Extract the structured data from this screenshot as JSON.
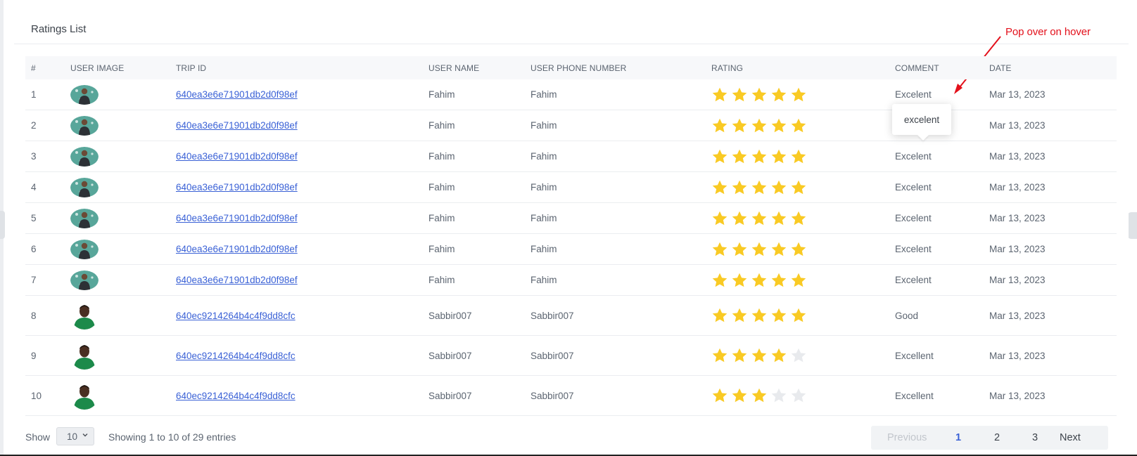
{
  "card": {
    "title": "Ratings List"
  },
  "annotation": {
    "text": "Pop over on hover"
  },
  "table": {
    "columns": [
      "#",
      "USER IMAGE",
      "TRIP ID",
      "USER NAME",
      "USER PHONE NUMBER",
      "RATING",
      "COMMENT",
      "DATE"
    ],
    "rows": [
      {
        "num": "1",
        "avatar": "avatar-outdoor",
        "trip_id": "640ea3e6e71901db2d0f98ef",
        "user_name": "Fahim",
        "phone": "Fahim",
        "rating": 5,
        "comment": "Excelent",
        "date": "Mar 13, 2023"
      },
      {
        "num": "2",
        "avatar": "avatar-outdoor",
        "trip_id": "640ea3e6e71901db2d0f98ef",
        "user_name": "Fahim",
        "phone": "Fahim",
        "rating": 5,
        "comment": "",
        "date": "Mar 13, 2023"
      },
      {
        "num": "3",
        "avatar": "avatar-outdoor",
        "trip_id": "640ea3e6e71901db2d0f98ef",
        "user_name": "Fahim",
        "phone": "Fahim",
        "rating": 5,
        "comment": "Excelent",
        "date": "Mar 13, 2023"
      },
      {
        "num": "4",
        "avatar": "avatar-outdoor",
        "trip_id": "640ea3e6e71901db2d0f98ef",
        "user_name": "Fahim",
        "phone": "Fahim",
        "rating": 5,
        "comment": "Excelent",
        "date": "Mar 13, 2023"
      },
      {
        "num": "5",
        "avatar": "avatar-outdoor",
        "trip_id": "640ea3e6e71901db2d0f98ef",
        "user_name": "Fahim",
        "phone": "Fahim",
        "rating": 5,
        "comment": "Excelent",
        "date": "Mar 13, 2023"
      },
      {
        "num": "6",
        "avatar": "avatar-outdoor",
        "trip_id": "640ea3e6e71901db2d0f98ef",
        "user_name": "Fahim",
        "phone": "Fahim",
        "rating": 5,
        "comment": "Excelent",
        "date": "Mar 13, 2023"
      },
      {
        "num": "7",
        "avatar": "avatar-outdoor",
        "trip_id": "640ea3e6e71901db2d0f98ef",
        "user_name": "Fahim",
        "phone": "Fahim",
        "rating": 5,
        "comment": "Excelent",
        "date": "Mar 13, 2023"
      },
      {
        "num": "8",
        "avatar": "avatar-portrait",
        "trip_id": "640ec9214264b4c4f9dd8cfc",
        "user_name": "Sabbir007",
        "phone": "Sabbir007",
        "rating": 5,
        "comment": "Good",
        "date": "Mar 13, 2023"
      },
      {
        "num": "9",
        "avatar": "avatar-portrait",
        "trip_id": "640ec9214264b4c4f9dd8cfc",
        "user_name": "Sabbir007",
        "phone": "Sabbir007",
        "rating": 4,
        "comment": "Excellent",
        "date": "Mar 13, 2023"
      },
      {
        "num": "10",
        "avatar": "avatar-portrait",
        "trip_id": "640ec9214264b4c4f9dd8cfc",
        "user_name": "Sabbir007",
        "phone": "Sabbir007",
        "rating": 3,
        "comment": "Excellent",
        "date": "Mar 13, 2023"
      }
    ],
    "max_rating": 5
  },
  "popover": {
    "text": "excelent"
  },
  "footer": {
    "show_label": "Show",
    "page_length": "10",
    "info": "Showing 1 to 10 of 29 entries",
    "pagination": {
      "previous": "Previous",
      "pages": [
        "1",
        "2",
        "3"
      ],
      "next": "Next",
      "active_page": "1"
    }
  },
  "colors": {
    "star_filled": "#f9ca24",
    "star_empty": "#e8eaed",
    "link": "#3a61d6",
    "annotation": "#e3101b"
  }
}
